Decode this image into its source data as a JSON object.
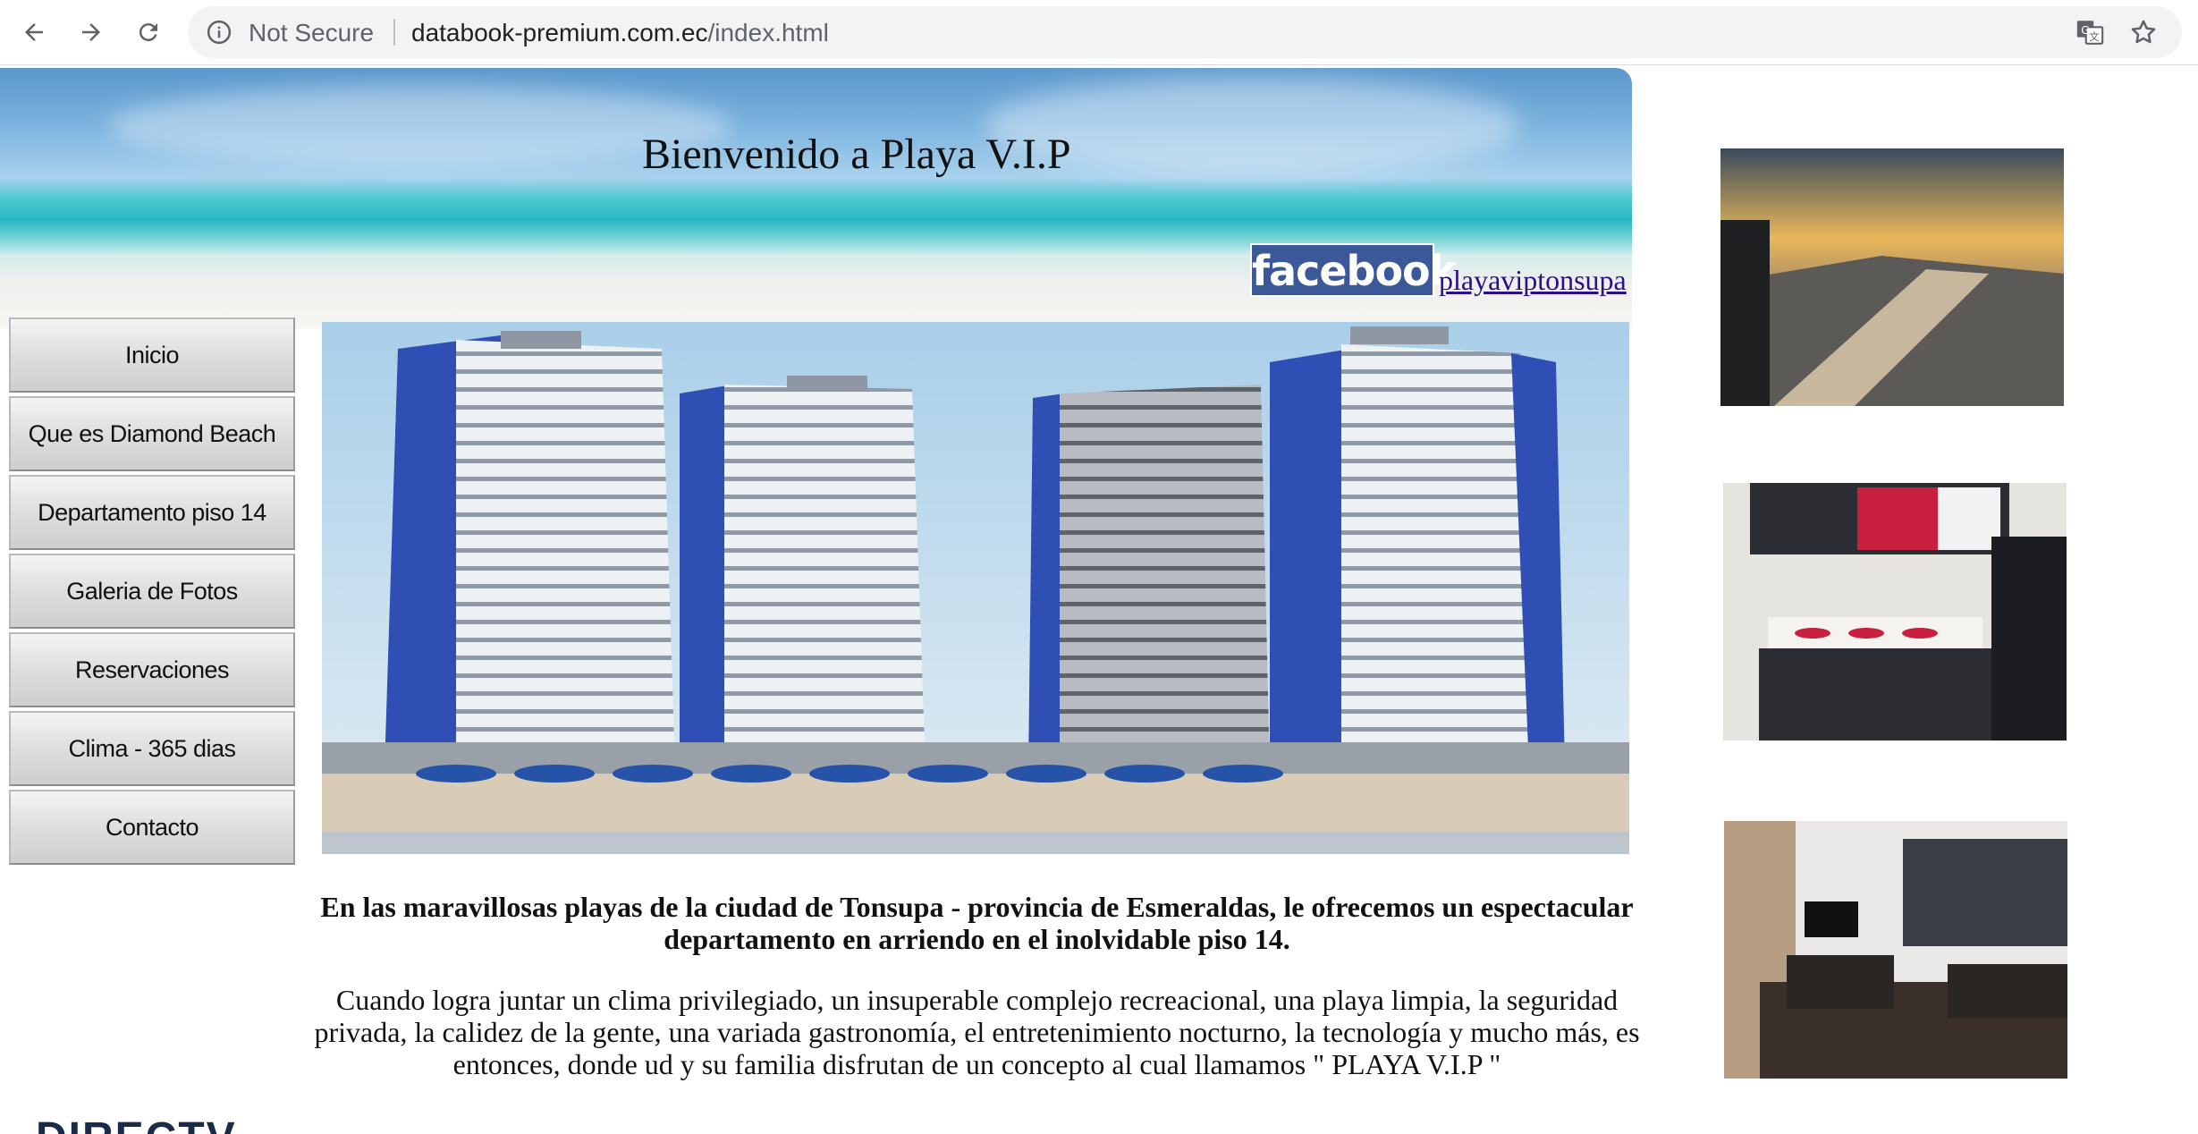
{
  "browser": {
    "security_label": "Not Secure",
    "url_host": "databook-premium.com.ec",
    "url_path": "/index.html"
  },
  "page": {
    "title": "Bienvenido a Playa V.I.P",
    "facebook_logo_text": "facebook",
    "facebook_link": "playaviptonsupa",
    "menu": [
      {
        "label": "Inicio"
      },
      {
        "label": "Que es Diamond Beach"
      },
      {
        "label": "Departamento piso 14"
      },
      {
        "label": "Galeria de Fotos"
      },
      {
        "label": "Reservaciones"
      },
      {
        "label": "Clima - 365 dias"
      },
      {
        "label": "Contacto"
      }
    ],
    "intro": "En las maravillosas playas de la ciudad de Tonsupa - provincia de Esmeraldas, le ofrecemos un espectacular departamento en arriendo en el inolvidable piso 14.",
    "body": "Cuando logra juntar un clima privilegiado, un insuperable complejo recreacional, una playa limpia, la seguridad privada, la calidez de la gente, una variada gastronomía, el entretenimiento nocturno, la tecnología y mucho más, es entonces, donde ud y su familia disfrutan de un concepto al cual llamamos \" PLAYA V.I.P \"",
    "bottom_logo": "DIRECTV"
  },
  "colors": {
    "facebook_blue": "#3b5998",
    "link_color": "#2a0f8a",
    "tower_blue": "#2f4fb5"
  }
}
